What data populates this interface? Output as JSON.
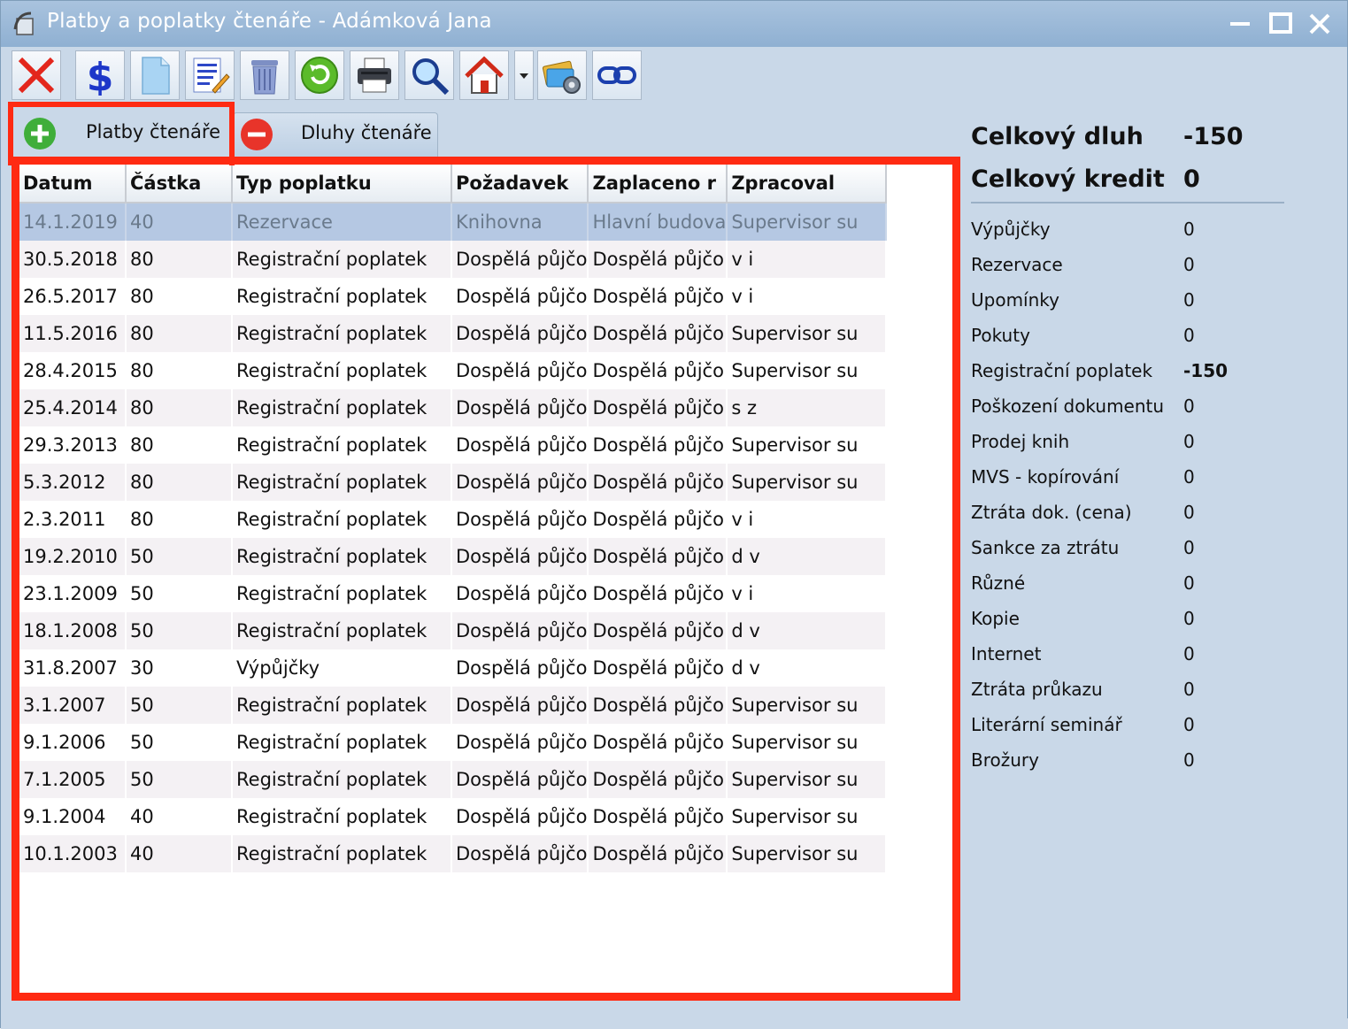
{
  "window": {
    "title": "Platby a poplatky čtenáře - Adámková Jana",
    "controls": {
      "minimize": "minimize-icon",
      "maximize": "maximize-icon",
      "close": "close-icon"
    }
  },
  "toolbar": {
    "buttons": [
      {
        "name": "delete",
        "icon": "red-x-icon"
      },
      {
        "name": "payment",
        "icon": "dollar-icon"
      },
      {
        "name": "new-document",
        "icon": "document-icon"
      },
      {
        "name": "edit",
        "icon": "edit-icon"
      },
      {
        "name": "trash",
        "icon": "trash-icon"
      },
      {
        "name": "refresh",
        "icon": "refresh-icon"
      },
      {
        "name": "print",
        "icon": "printer-icon"
      },
      {
        "name": "search",
        "icon": "magnifier-icon"
      },
      {
        "name": "home",
        "icon": "home-icon"
      },
      {
        "name": "card-settings",
        "icon": "card-gear-icon"
      },
      {
        "name": "link",
        "icon": "link-icon"
      }
    ]
  },
  "tabs": [
    {
      "label": "Platby čtenáře",
      "icon": "plus-circle-icon",
      "active": true
    },
    {
      "label": "Dluhy čtenáře",
      "icon": "minus-circle-icon",
      "active": false
    }
  ],
  "grid": {
    "columns": [
      "Datum",
      "Částka",
      "Typ poplatku",
      "Požadavek",
      "Zaplaceno r",
      "Zpracoval"
    ],
    "rows": [
      [
        "14.1.2019",
        "40",
        "Rezervace",
        "Knihovna",
        "Hlavní budova",
        "Supervisor su"
      ],
      [
        "30.5.2018",
        "80",
        "Registrační poplatek",
        "Dospělá půjčo",
        "Dospělá půjčo",
        "v i"
      ],
      [
        "26.5.2017",
        "80",
        "Registrační poplatek",
        "Dospělá půjčo",
        "Dospělá půjčo",
        "v i"
      ],
      [
        "11.5.2016",
        "80",
        "Registrační poplatek",
        "Dospělá půjčo",
        "Dospělá půjčo",
        "Supervisor su"
      ],
      [
        "28.4.2015",
        "80",
        "Registrační poplatek",
        "Dospělá půjčo",
        "Dospělá půjčo",
        "Supervisor su"
      ],
      [
        "25.4.2014",
        "80",
        "Registrační poplatek",
        "Dospělá půjčo",
        "Dospělá půjčo",
        "s z"
      ],
      [
        "29.3.2013",
        "80",
        "Registrační poplatek",
        "Dospělá půjčo",
        "Dospělá půjčo",
        "Supervisor su"
      ],
      [
        "5.3.2012",
        "80",
        "Registrační poplatek",
        "Dospělá půjčo",
        "Dospělá půjčo",
        "Supervisor su"
      ],
      [
        "2.3.2011",
        "80",
        "Registrační poplatek",
        "Dospělá půjčo",
        "Dospělá půjčo",
        "v i"
      ],
      [
        "19.2.2010",
        "50",
        "Registrační poplatek",
        "Dospělá půjčo",
        "Dospělá půjčo",
        "d v"
      ],
      [
        "23.1.2009",
        "50",
        "Registrační poplatek",
        "Dospělá půjčo",
        "Dospělá půjčo",
        "v i"
      ],
      [
        "18.1.2008",
        "50",
        "Registrační poplatek",
        "Dospělá půjčo",
        "Dospělá půjčo",
        "d v"
      ],
      [
        "31.8.2007",
        "30",
        "Výpůjčky",
        "Dospělá půjčo",
        "Dospělá půjčo",
        "d v"
      ],
      [
        "3.1.2007",
        "50",
        "Registrační poplatek",
        "Dospělá půjčo",
        "Dospělá půjčo",
        "Supervisor su"
      ],
      [
        "9.1.2006",
        "50",
        "Registrační poplatek",
        "Dospělá půjčo",
        "Dospělá půjčo",
        "Supervisor su"
      ],
      [
        "7.1.2005",
        "50",
        "Registrační poplatek",
        "Dospělá půjčo",
        "Dospělá půjčo",
        "Supervisor su"
      ],
      [
        "9.1.2004",
        "40",
        "Registrační poplatek",
        "Dospělá půjčo",
        "Dospělá půjčo",
        "Supervisor su"
      ],
      [
        "10.1.2003",
        "40",
        "Registrační poplatek",
        "Dospělá půjčo",
        "Dospělá půjčo",
        "Supervisor su"
      ]
    ],
    "selected_row": 0
  },
  "summary": {
    "total_debt_label": "Celkový dluh",
    "total_debt_value": "-150",
    "total_credit_label": "Celkový kredit",
    "total_credit_value": "0"
  },
  "categories": [
    {
      "label": "Výpůjčky",
      "value": "0"
    },
    {
      "label": "Rezervace",
      "value": "0"
    },
    {
      "label": "Upomínky",
      "value": "0"
    },
    {
      "label": "Pokuty",
      "value": "0"
    },
    {
      "label": "Registrační poplatek",
      "value": "-150",
      "bold": true
    },
    {
      "label": "Poškození dokumentu",
      "value": "0"
    },
    {
      "label": "Prodej knih",
      "value": "0"
    },
    {
      "label": "MVS - kopírování",
      "value": "0"
    },
    {
      "label": "Ztráta dok. (cena)",
      "value": "0"
    },
    {
      "label": "Sankce za ztrátu",
      "value": "0"
    },
    {
      "label": "Různé",
      "value": "0"
    },
    {
      "label": "Kopie",
      "value": "0"
    },
    {
      "label": "Internet",
      "value": "0"
    },
    {
      "label": "Ztráta průkazu",
      "value": "0"
    },
    {
      "label": "Literární seminář",
      "value": "0"
    },
    {
      "label": "Brožury",
      "value": "0"
    }
  ],
  "colors": {
    "highlight": "#ff2a12",
    "selected_row": "#b5c8e3",
    "window_bg": "#c9d8e8"
  }
}
